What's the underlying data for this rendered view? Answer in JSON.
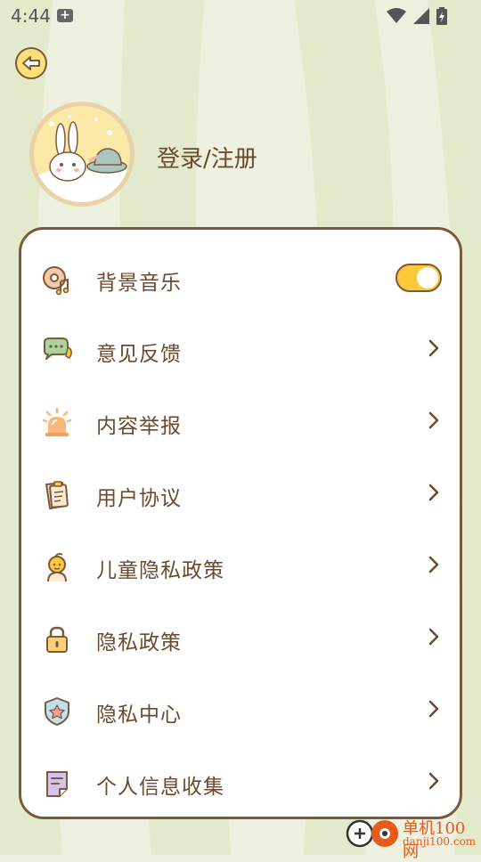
{
  "status": {
    "time": "4:44"
  },
  "profile": {
    "login_label": "登录/注册"
  },
  "settings": {
    "background_music": {
      "label": "背景音乐",
      "enabled": true
    },
    "items": [
      {
        "label": "意见反馈",
        "icon": "chat-bubbles-icon"
      },
      {
        "label": "内容举报",
        "icon": "alarm-light-icon"
      },
      {
        "label": "用户协议",
        "icon": "clipboard-icon"
      },
      {
        "label": "儿童隐私政策",
        "icon": "child-icon"
      },
      {
        "label": "隐私政策",
        "icon": "lock-icon"
      },
      {
        "label": "隐私中心",
        "icon": "shield-star-icon"
      },
      {
        "label": "个人信息收集",
        "icon": "note-icon"
      }
    ]
  },
  "watermark": {
    "main": "单机100网",
    "sub": "danji100.com"
  }
}
